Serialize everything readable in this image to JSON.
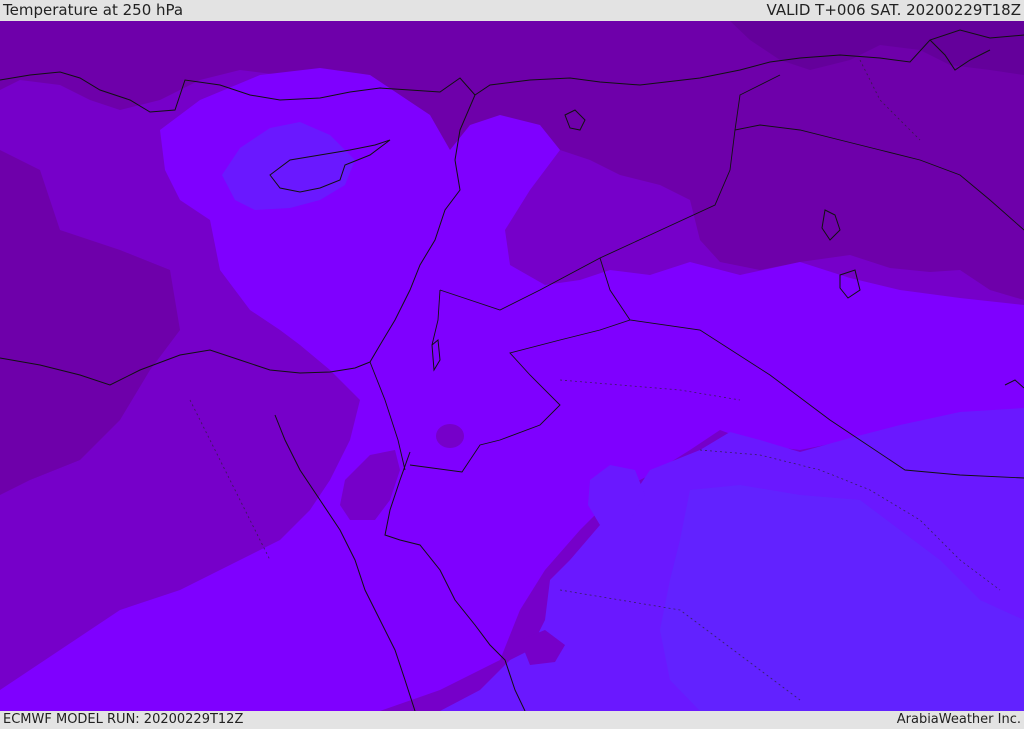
{
  "header": {
    "title": "Temperature at 250 hPa",
    "valid_time": "VALID T+006 SAT. 20200229T18Z"
  },
  "footer": {
    "model_run": "ECMWF MODEL RUN: 20200229T12Z",
    "credit": "ArabiaWeather Inc."
  },
  "map": {
    "field": "temperature",
    "level": "250 hPa",
    "palette": {
      "darkest": "#64009b",
      "dark": "#6e00aa",
      "mid_dark": "#7600c9",
      "mid": "#7f00ff",
      "light": "#6a18ff",
      "lightest": "#5b2cff"
    }
  }
}
